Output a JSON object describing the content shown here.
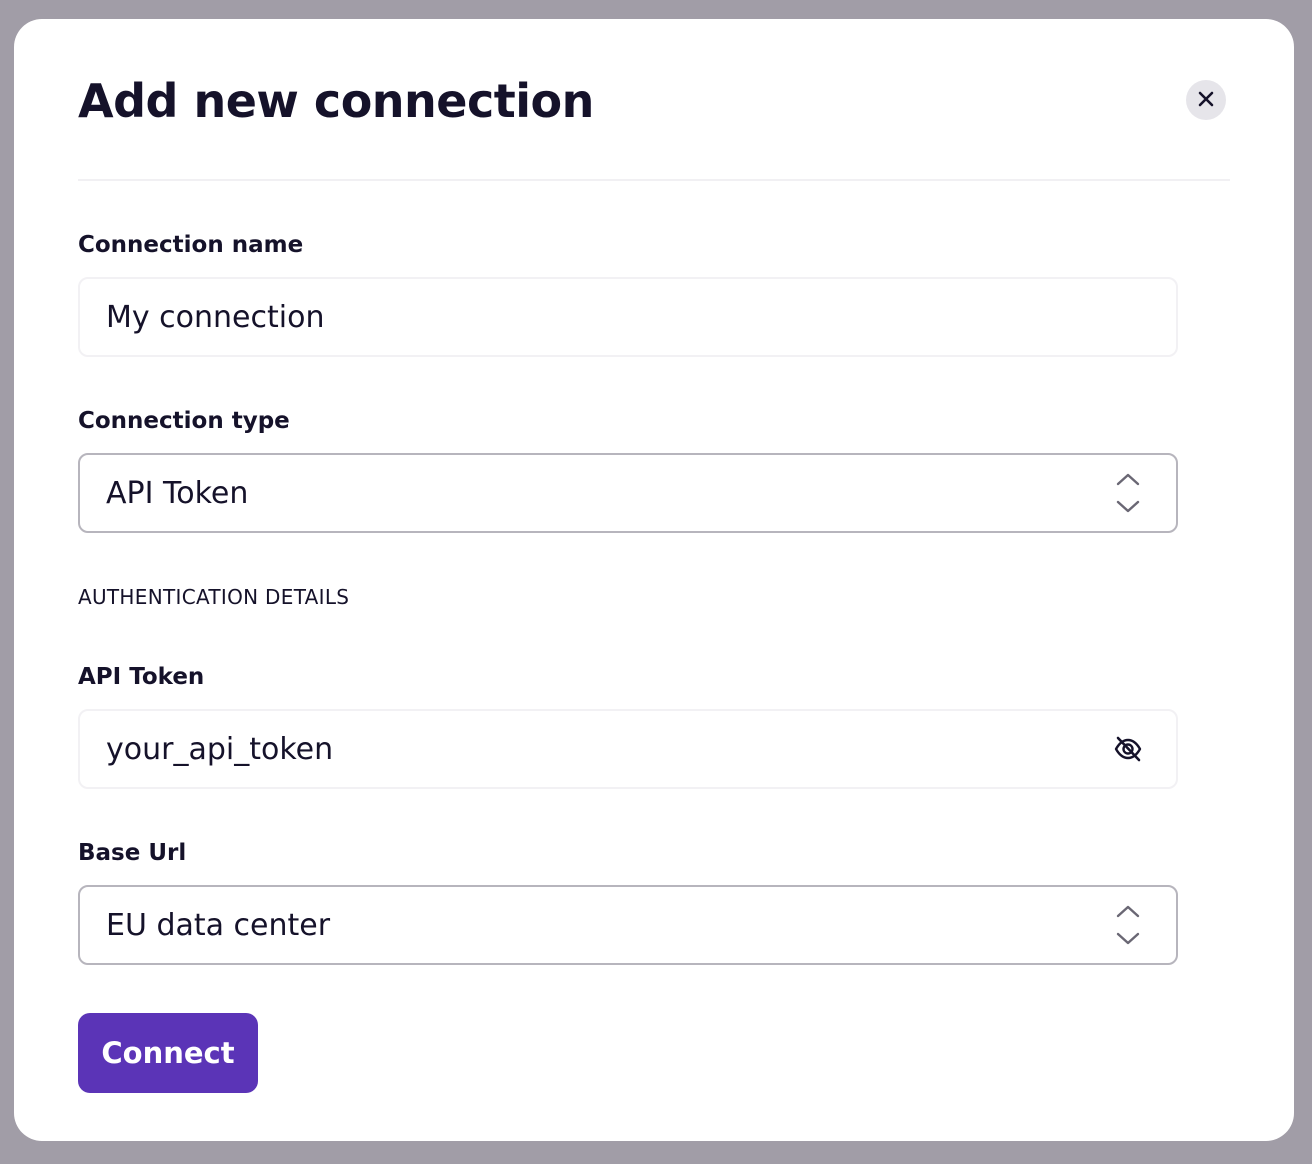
{
  "dialog": {
    "title": "Add new connection",
    "close_icon": "close-icon"
  },
  "form": {
    "connection_name": {
      "label": "Connection name",
      "value": "My connection"
    },
    "connection_type": {
      "label": "Connection type",
      "value": "API Token",
      "icon": "chevron-up-down-icon"
    },
    "auth_section_title": "AUTHENTICATION DETAILS",
    "api_token": {
      "label": "API Token",
      "value": "your_api_token",
      "icon": "eye-off-icon"
    },
    "base_url": {
      "label": "Base Url",
      "value": "EU data center",
      "icon": "chevron-up-down-icon"
    },
    "submit_label": "Connect"
  },
  "colors": {
    "accent": "#5b34b7",
    "text": "#15122a",
    "backdrop": "#a19da7"
  }
}
